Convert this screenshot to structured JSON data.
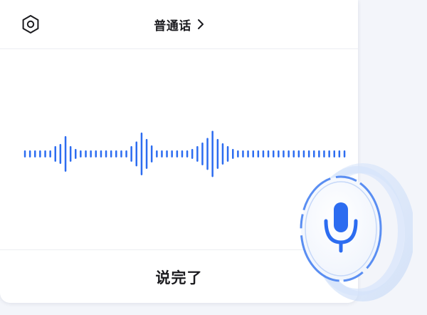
{
  "header": {
    "language_label": "普通话",
    "settings_icon": "hexagon-settings-icon",
    "chevron_icon": "chevron-right-icon"
  },
  "waveform": {
    "color": "#2c6cf0",
    "bar_levels": [
      0.1,
      0.1,
      0.1,
      0.1,
      0.1,
      0.1,
      0.22,
      0.28,
      0.5,
      0.22,
      0.14,
      0.1,
      0.1,
      0.1,
      0.1,
      0.1,
      0.1,
      0.1,
      0.1,
      0.1,
      0.1,
      0.22,
      0.35,
      0.6,
      0.42,
      0.24,
      0.1,
      0.1,
      0.1,
      0.1,
      0.1,
      0.1,
      0.1,
      0.14,
      0.22,
      0.32,
      0.45,
      0.65,
      0.42,
      0.3,
      0.22,
      0.14,
      0.1,
      0.1,
      0.1,
      0.1,
      0.1,
      0.1,
      0.1,
      0.1,
      0.1,
      0.1,
      0.1,
      0.1,
      0.1,
      0.1,
      0.1,
      0.1,
      0.1,
      0.1,
      0.1,
      0.1,
      0.1,
      0.1
    ]
  },
  "footer": {
    "done_label": "说完了"
  },
  "mic": {
    "icon": "microphone-icon",
    "accent": "#2c6cf0",
    "ring_color": "#8fb5f5"
  }
}
